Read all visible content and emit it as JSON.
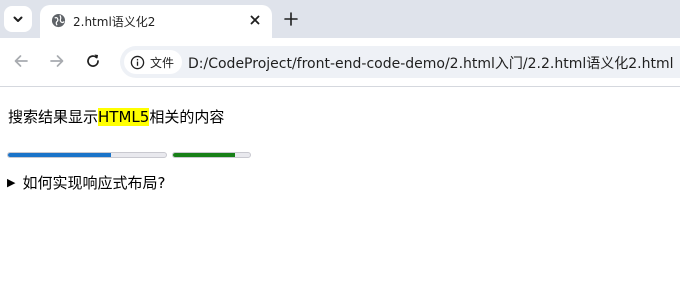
{
  "browser": {
    "tab": {
      "title": "2.html语义化2"
    },
    "address_bar": {
      "site_info_label": "文件",
      "url": "D:/CodeProject/front-end-code-demo/2.html入门/2.2.html语义化2.html"
    }
  },
  "page": {
    "search_text_before": "搜索结果显示",
    "search_text_highlight": "HTML5",
    "search_text_after": "相关的内容",
    "progress_bar": {
      "value": 0.65,
      "color": "#1a73c8"
    },
    "meter": {
      "value": 0.8,
      "color": "#188018"
    },
    "details": {
      "summary": "如何实现响应式布局?",
      "marker": "▶"
    },
    "highlight_color": "#ffff00"
  }
}
